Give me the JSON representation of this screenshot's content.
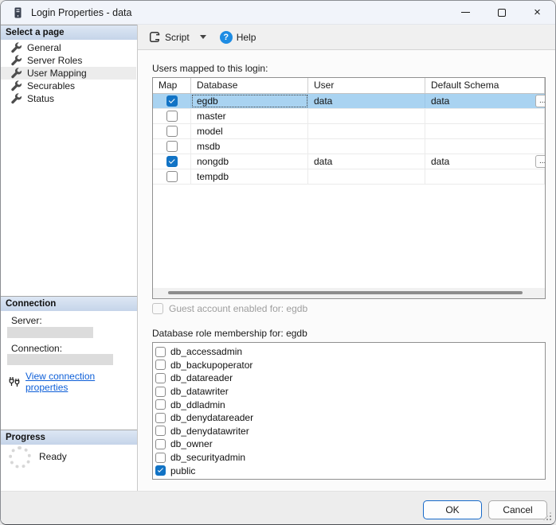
{
  "window": {
    "title": "Login Properties - data"
  },
  "titlebar": {
    "close_glyph": "×"
  },
  "sidebar": {
    "pages": {
      "header": "Select a page",
      "items": [
        "General",
        "Server Roles",
        "User Mapping",
        "Securables",
        "Status"
      ],
      "selected_index": 2
    },
    "connection": {
      "header": "Connection",
      "server_label": "Server:",
      "connection_label": "Connection:",
      "link_label": "View connection properties"
    },
    "progress": {
      "header": "Progress",
      "status": "Ready"
    }
  },
  "toolbar": {
    "script_label": "Script",
    "help_label": "Help",
    "help_glyph": "?"
  },
  "main": {
    "users_mapped_label": "Users mapped to this login:",
    "table": {
      "columns": [
        "Map",
        "Database",
        "User",
        "Default Schema"
      ],
      "ellipsis_label": "...",
      "rows": [
        {
          "map": true,
          "database": "egdb",
          "user": "data",
          "default_schema": "data",
          "selected": true,
          "ellipsis": true
        },
        {
          "map": false,
          "database": "master",
          "user": "",
          "default_schema": "",
          "selected": false,
          "ellipsis": false
        },
        {
          "map": false,
          "database": "model",
          "user": "",
          "default_schema": "",
          "selected": false,
          "ellipsis": false
        },
        {
          "map": false,
          "database": "msdb",
          "user": "",
          "default_schema": "",
          "selected": false,
          "ellipsis": false
        },
        {
          "map": true,
          "database": "nongdb",
          "user": "data",
          "default_schema": "data",
          "selected": false,
          "ellipsis": true
        },
        {
          "map": false,
          "database": "tempdb",
          "user": "",
          "default_schema": "",
          "selected": false,
          "ellipsis": false
        }
      ]
    },
    "guest_label": "Guest account enabled for: egdb",
    "guest_checked": false,
    "roles_label": "Database role membership for: egdb",
    "roles": [
      {
        "name": "db_accessadmin",
        "checked": false
      },
      {
        "name": "db_backupoperator",
        "checked": false
      },
      {
        "name": "db_datareader",
        "checked": false
      },
      {
        "name": "db_datawriter",
        "checked": false
      },
      {
        "name": "db_ddladmin",
        "checked": false
      },
      {
        "name": "db_denydatareader",
        "checked": false
      },
      {
        "name": "db_denydatawriter",
        "checked": false
      },
      {
        "name": "db_owner",
        "checked": false
      },
      {
        "name": "db_securityadmin",
        "checked": false
      },
      {
        "name": "public",
        "checked": true
      }
    ]
  },
  "footer": {
    "ok_label": "OK",
    "cancel_label": "Cancel"
  },
  "colors": {
    "selection": "#a9d3f1",
    "checkbox": "#1173c5",
    "link": "#0e5fd8",
    "help_icon": "#1e8ce3",
    "header_gradient_top": "#dde7f4",
    "header_gradient_bottom": "#c5d4e9"
  }
}
